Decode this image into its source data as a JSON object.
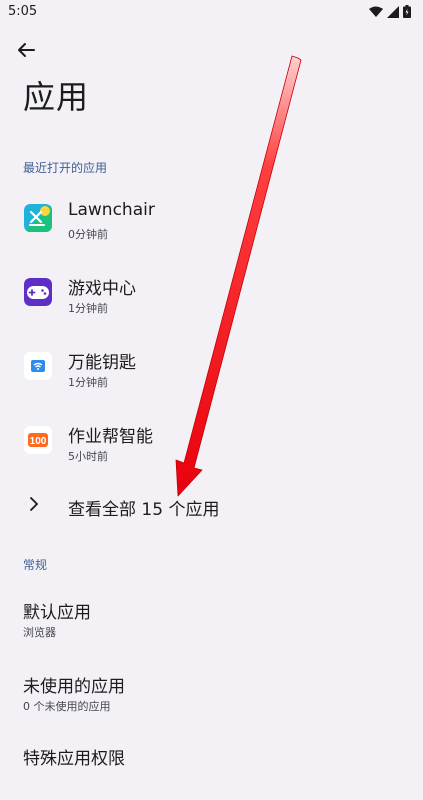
{
  "status_bar": {
    "time": "5:05"
  },
  "header": {
    "title": "应用"
  },
  "recent": {
    "header": "最近打开的应用",
    "apps": [
      {
        "name": "Lawnchair",
        "sub": "0分钟前",
        "icon": "lawnchair-icon"
      },
      {
        "name": "游戏中心",
        "sub": "1分钟前",
        "icon": "game-center-icon"
      },
      {
        "name": "万能钥匙",
        "sub": "1分钟前",
        "icon": "wifi-key-icon"
      },
      {
        "name": "作业帮智能",
        "sub": "5小时前",
        "icon": "zuoyebang-icon"
      }
    ],
    "see_all": "查看全部 15 个应用"
  },
  "general": {
    "header": "常规",
    "items": [
      {
        "title": "默认应用",
        "sub": "浏览器"
      },
      {
        "title": "未使用的应用",
        "sub": "0 个未使用的应用"
      },
      {
        "title": "特殊应用权限",
        "sub": ""
      }
    ]
  },
  "colors": {
    "background": "#f3f1f6",
    "accent": "#3f5f90",
    "annotation": "#e8000b"
  },
  "icons": {
    "zuoyebang_badge": "100"
  }
}
